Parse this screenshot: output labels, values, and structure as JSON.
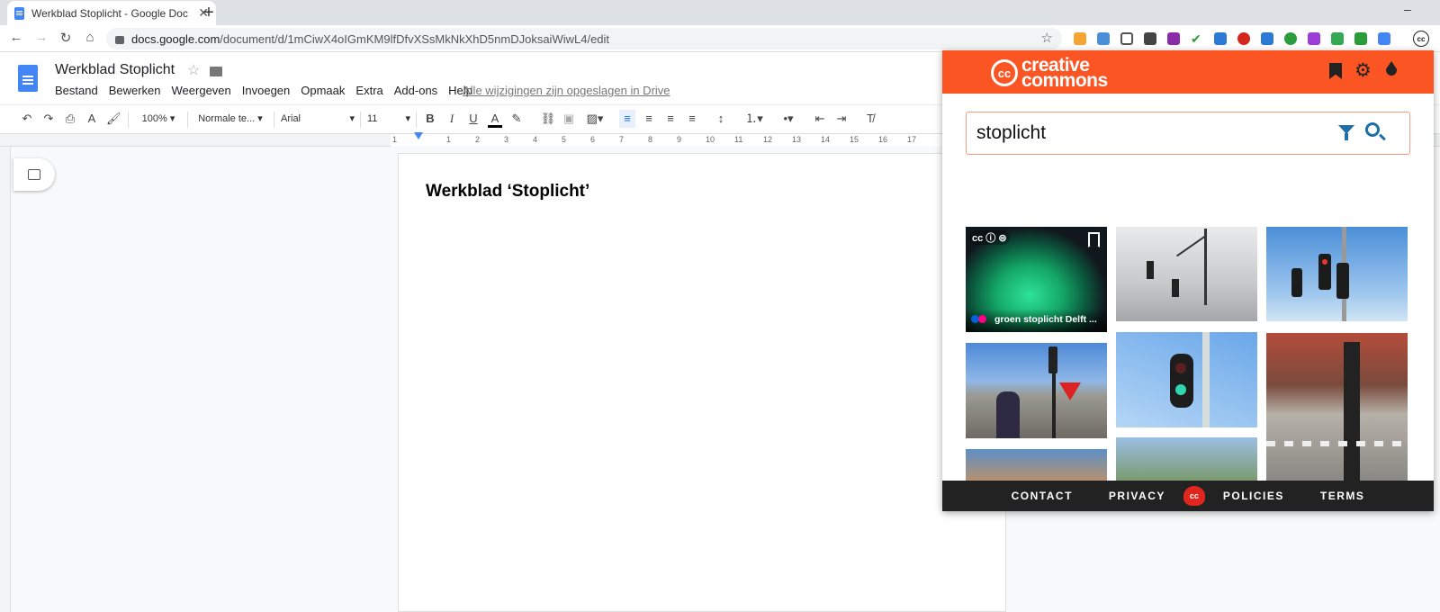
{
  "browser": {
    "tab_title": "Werkblad Stoplicht - Google Doc",
    "url_host": "docs.google.com",
    "url_path": "/document/d/1mCiwX4oIGmKM9lfDfvXSsMkNkXhD5nmDJoksaiWiwL4/edit",
    "new_tab": "+",
    "min": "–"
  },
  "docs": {
    "title": "Werkblad Stoplicht",
    "menu": [
      "Bestand",
      "Bewerken",
      "Weergeven",
      "Invoegen",
      "Opmaak",
      "Extra",
      "Add-ons",
      "Help"
    ],
    "saved_message": "Alle wijzigingen zijn opgeslagen in Drive",
    "toolbar": {
      "zoom": "100%",
      "style": "Normale te...",
      "font": "Arial",
      "size": "11"
    },
    "ruler_ticks": [
      "1",
      "1",
      "2",
      "3",
      "4",
      "5",
      "6",
      "7",
      "8",
      "9",
      "10",
      "11",
      "12",
      "13",
      "14",
      "15",
      "16",
      "17"
    ],
    "heading": "Werkblad ‘Stoplicht’"
  },
  "cc": {
    "logo_small": "cc",
    "logo_line1": "creative",
    "logo_line2": "commons",
    "search_value": "stoplicht",
    "first_image_caption": "groen stoplicht Delft ...",
    "license_icons": "cc ⓘ ⊜",
    "footer": [
      "CONTACT",
      "PRIVACY",
      "POLICIES",
      "TERMS"
    ],
    "footer_logo": "cc",
    "brand_color": "#fb5524",
    "accent_color": "#1e6fa8"
  }
}
